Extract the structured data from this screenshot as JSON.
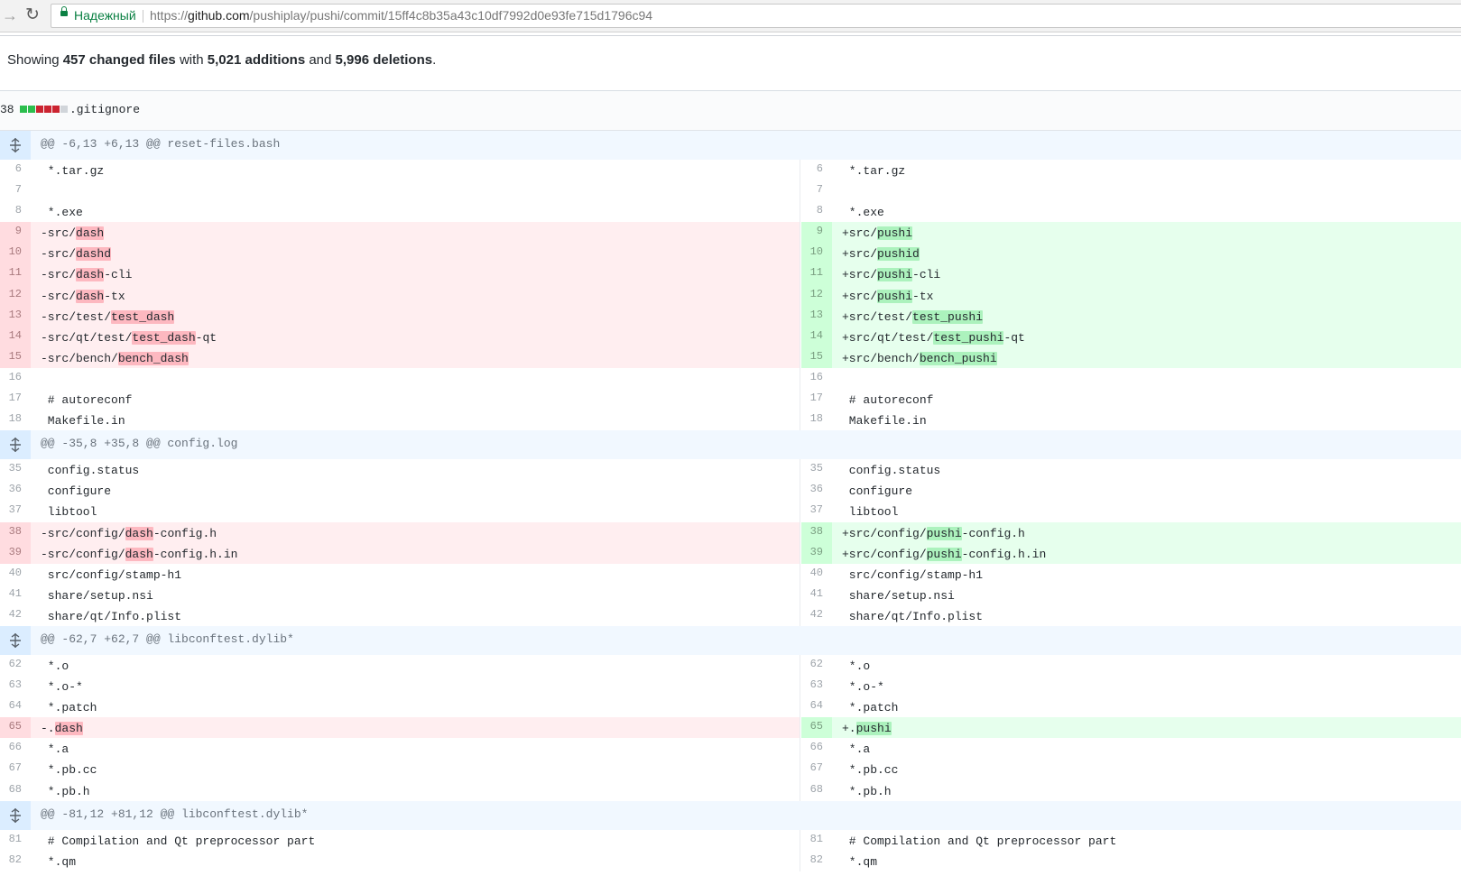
{
  "browser": {
    "secure_label": "Надежный",
    "url_scheme": "https://",
    "url_host": "github.com",
    "url_path": "/pushiplay/pushi/commit/15ff4c8b35a43c10df7992d0e93fe715d1796c94"
  },
  "summary": {
    "prefix": "Showing ",
    "files": "457 changed files",
    "with": " with ",
    "additions": "5,021 additions",
    "and": " and ",
    "deletions": "5,996 deletions",
    "end": "."
  },
  "file": {
    "count": "38",
    "name": ".gitignore",
    "diffstat": [
      "add",
      "add",
      "del",
      "del",
      "del",
      "neutral"
    ]
  },
  "rows": [
    {
      "type": "hunk",
      "text": "@@ -6,13 +6,13 @@ reset-files.bash"
    },
    {
      "type": "ctx",
      "ln": "6",
      "rn": "6",
      "code": " *.tar.gz"
    },
    {
      "type": "ctx",
      "ln": "7",
      "rn": "7",
      "code": ""
    },
    {
      "type": "ctx",
      "ln": "8",
      "rn": "8",
      "code": " *.exe"
    },
    {
      "type": "chg",
      "ln": "9",
      "rn": "9",
      "l": [
        [
          "-src/",
          false
        ],
        [
          "dash",
          true
        ]
      ],
      "r": [
        [
          "+src/",
          false
        ],
        [
          "pushi",
          true
        ]
      ]
    },
    {
      "type": "chg",
      "ln": "10",
      "rn": "10",
      "l": [
        [
          "-src/",
          false
        ],
        [
          "dashd",
          true
        ]
      ],
      "r": [
        [
          "+src/",
          false
        ],
        [
          "pushid",
          true
        ]
      ]
    },
    {
      "type": "chg",
      "ln": "11",
      "rn": "11",
      "l": [
        [
          "-src/",
          false
        ],
        [
          "dash",
          true
        ],
        [
          "-cli",
          false
        ]
      ],
      "r": [
        [
          "+src/",
          false
        ],
        [
          "pushi",
          true
        ],
        [
          "-cli",
          false
        ]
      ]
    },
    {
      "type": "chg",
      "ln": "12",
      "rn": "12",
      "l": [
        [
          "-src/",
          false
        ],
        [
          "dash",
          true
        ],
        [
          "-tx",
          false
        ]
      ],
      "r": [
        [
          "+src/",
          false
        ],
        [
          "pushi",
          true
        ],
        [
          "-tx",
          false
        ]
      ]
    },
    {
      "type": "chg",
      "ln": "13",
      "rn": "13",
      "l": [
        [
          "-src/test/",
          false
        ],
        [
          "test_dash",
          true
        ]
      ],
      "r": [
        [
          "+src/test/",
          false
        ],
        [
          "test_pushi",
          true
        ]
      ]
    },
    {
      "type": "chg",
      "ln": "14",
      "rn": "14",
      "l": [
        [
          "-src/qt/test/",
          false
        ],
        [
          "test_dash",
          true
        ],
        [
          "-qt",
          false
        ]
      ],
      "r": [
        [
          "+src/qt/test/",
          false
        ],
        [
          "test_pushi",
          true
        ],
        [
          "-qt",
          false
        ]
      ]
    },
    {
      "type": "chg",
      "ln": "15",
      "rn": "15",
      "l": [
        [
          "-src/bench/",
          false
        ],
        [
          "bench_dash",
          true
        ]
      ],
      "r": [
        [
          "+src/bench/",
          false
        ],
        [
          "bench_pushi",
          true
        ]
      ]
    },
    {
      "type": "ctx",
      "ln": "16",
      "rn": "16",
      "code": ""
    },
    {
      "type": "ctx",
      "ln": "17",
      "rn": "17",
      "code": " # autoreconf"
    },
    {
      "type": "ctx",
      "ln": "18",
      "rn": "18",
      "code": " Makefile.in"
    },
    {
      "type": "hunk",
      "text": "@@ -35,8 +35,8 @@ config.log"
    },
    {
      "type": "ctx",
      "ln": "35",
      "rn": "35",
      "code": " config.status"
    },
    {
      "type": "ctx",
      "ln": "36",
      "rn": "36",
      "code": " configure"
    },
    {
      "type": "ctx",
      "ln": "37",
      "rn": "37",
      "code": " libtool"
    },
    {
      "type": "chg",
      "ln": "38",
      "rn": "38",
      "l": [
        [
          "-src/config/",
          false
        ],
        [
          "dash",
          true
        ],
        [
          "-config.h",
          false
        ]
      ],
      "r": [
        [
          "+src/config/",
          false
        ],
        [
          "pushi",
          true
        ],
        [
          "-config.h",
          false
        ]
      ]
    },
    {
      "type": "chg",
      "ln": "39",
      "rn": "39",
      "l": [
        [
          "-src/config/",
          false
        ],
        [
          "dash",
          true
        ],
        [
          "-config.h.in",
          false
        ]
      ],
      "r": [
        [
          "+src/config/",
          false
        ],
        [
          "pushi",
          true
        ],
        [
          "-config.h.in",
          false
        ]
      ]
    },
    {
      "type": "ctx",
      "ln": "40",
      "rn": "40",
      "code": " src/config/stamp-h1"
    },
    {
      "type": "ctx",
      "ln": "41",
      "rn": "41",
      "code": " share/setup.nsi"
    },
    {
      "type": "ctx",
      "ln": "42",
      "rn": "42",
      "code": " share/qt/Info.plist"
    },
    {
      "type": "hunk",
      "text": "@@ -62,7 +62,7 @@ libconftest.dylib*"
    },
    {
      "type": "ctx",
      "ln": "62",
      "rn": "62",
      "code": " *.o"
    },
    {
      "type": "ctx",
      "ln": "63",
      "rn": "63",
      "code": " *.o-*"
    },
    {
      "type": "ctx",
      "ln": "64",
      "rn": "64",
      "code": " *.patch"
    },
    {
      "type": "chg",
      "ln": "65",
      "rn": "65",
      "l": [
        [
          "-.",
          false
        ],
        [
          "dash",
          true
        ]
      ],
      "r": [
        [
          "+.",
          false
        ],
        [
          "pushi",
          true
        ]
      ]
    },
    {
      "type": "ctx",
      "ln": "66",
      "rn": "66",
      "code": " *.a"
    },
    {
      "type": "ctx",
      "ln": "67",
      "rn": "67",
      "code": " *.pb.cc"
    },
    {
      "type": "ctx",
      "ln": "68",
      "rn": "68",
      "code": " *.pb.h"
    },
    {
      "type": "hunk",
      "text": "@@ -81,12 +81,12 @@ libconftest.dylib*"
    },
    {
      "type": "ctx",
      "ln": "81",
      "rn": "81",
      "code": " # Compilation and Qt preprocessor part"
    },
    {
      "type": "ctx",
      "ln": "82",
      "rn": "82",
      "code": " *.qm"
    }
  ]
}
